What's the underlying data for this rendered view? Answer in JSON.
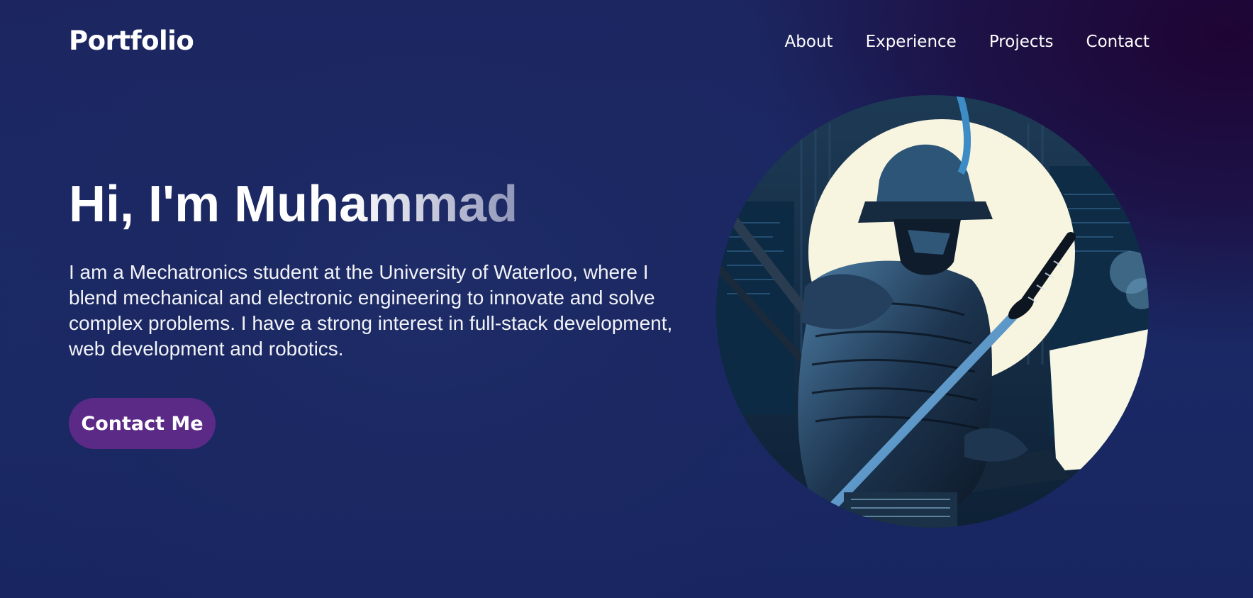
{
  "header": {
    "logo": "Portfolio",
    "nav": [
      "About",
      "Experience",
      "Projects",
      "Contact"
    ]
  },
  "hero": {
    "title": "Hi, I'm Muhammad",
    "description": "I am a Mechatronics student at the University of Waterloo, where I blend mechanical and electronic engineering to innovate and solve complex problems. I have a strong interest in full-stack development, web development and robotics.",
    "cta_label": "Contact Me"
  },
  "colors": {
    "background_navy": "#1a2a66",
    "background_purple": "#1e0434",
    "button_purple": "#5b2a86",
    "text": "#ffffff"
  }
}
